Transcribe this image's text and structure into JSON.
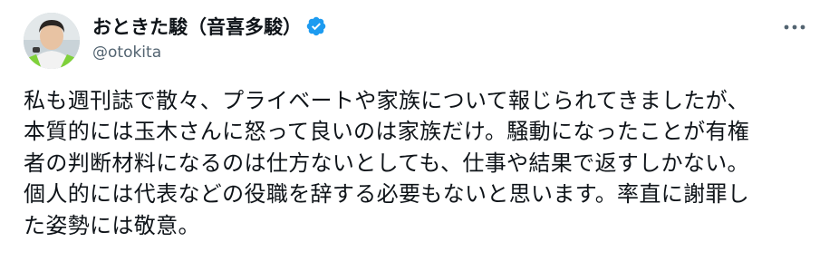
{
  "author": {
    "display_name": "おときた駿（音喜多駿）",
    "handle": "@otokita",
    "verified": true,
    "verified_color": "#1d9bf0"
  },
  "icons": {
    "verified": "verified-badge-icon",
    "more": "more-options-icon"
  },
  "post": {
    "lines": [
      "私も週刊誌で散々、プライベートや家族について報じられてきましたが、",
      "本質的には玉木さんに怒って良いのは家族だけ。騒動になったことが有権",
      "者の判断材料になるのは仕方ないとしても、仕事や結果で返すしかない。",
      "個人的には代表などの役職を辞する必要もないと思います。率直に謝罪し",
      "た姿勢には敬意。"
    ]
  }
}
